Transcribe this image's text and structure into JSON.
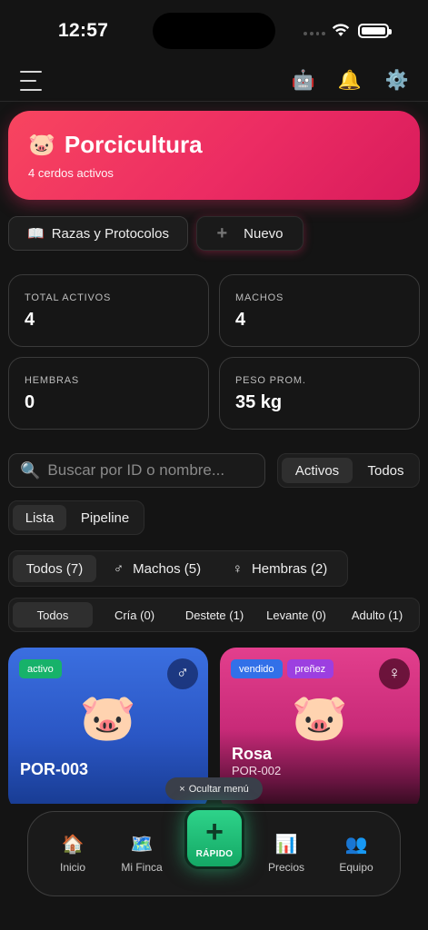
{
  "status_bar": {
    "time": "12:57"
  },
  "topbar": {
    "icons": [
      "menu-icon",
      "robot-icon",
      "bell-icon",
      "gear-icon"
    ],
    "robot_glyph": "🤖",
    "bell_glyph": "🔔",
    "gear_glyph": "⚙️"
  },
  "hero": {
    "emoji": "🐷",
    "title": "Porcicultura",
    "subtitle": "4 cerdos activos",
    "gradient_start": "#f8455f",
    "gradient_end": "#d81b5c"
  },
  "actions": {
    "razas_icon": "📖",
    "razas_label": "Razas y Protocolos",
    "nuevo_icon": "+",
    "nuevo_label": "Nuevo"
  },
  "stats": [
    {
      "label": "TOTAL ACTIVOS",
      "value": "4"
    },
    {
      "label": "MACHOS",
      "value": "4"
    },
    {
      "label": "HEMBRAS",
      "value": "0"
    },
    {
      "label": "PESO PROM.",
      "value": "35 kg"
    }
  ],
  "search": {
    "placeholder": "Buscar por ID o nombre...",
    "icon": "🔍"
  },
  "status_filter": {
    "options": [
      "Activos",
      "Todos"
    ],
    "selected": "Activos"
  },
  "view_toggle": {
    "options": [
      "Lista",
      "Pipeline"
    ],
    "selected": "Lista"
  },
  "sex_filter": {
    "todos": "Todos (7)",
    "machos_icon": "♂",
    "machos": "Machos (5)",
    "hembras_icon": "♀",
    "hembras": "Hembras (2)",
    "selected": "Todos (7)"
  },
  "stage_filter": {
    "options": [
      "Todos",
      "Cría (0)",
      "Destete (1)",
      "Levante (0)",
      "Adulto (1)"
    ],
    "selected": "Todos"
  },
  "animals": [
    {
      "badges": [
        "activo"
      ],
      "gender_icon": "♂",
      "emoji": "🐷",
      "name": "POR-003",
      "id": ""
    },
    {
      "badges": [
        "vendido",
        "preñez"
      ],
      "gender_icon": "♀",
      "emoji": "🐷",
      "name": "Rosa",
      "id": "POR-002"
    }
  ],
  "hide_menu": {
    "label": "Ocultar menú",
    "icon": "×"
  },
  "bottom_nav": {
    "items": [
      {
        "label": "Inicio",
        "icon": "🏠"
      },
      {
        "label": "Mi Finca",
        "icon": "🗺️"
      },
      {
        "label": "Precios",
        "icon": "📊"
      },
      {
        "label": "Equipo",
        "icon": "👥"
      }
    ],
    "fab_icon": "+",
    "fab_label": "RÁPIDO",
    "fab_color": "#2ed38a"
  }
}
